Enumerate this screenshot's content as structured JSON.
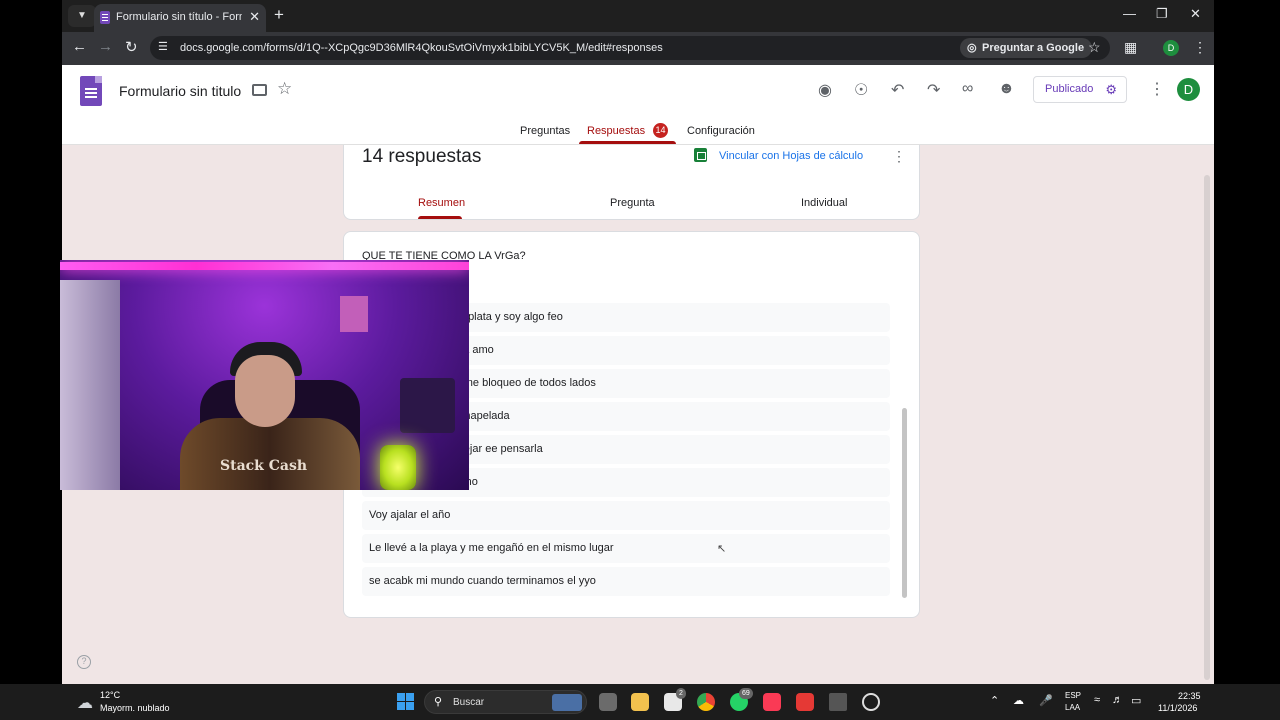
{
  "browser": {
    "tab_title": "Formulario sin título - Formular",
    "url": "docs.google.com/forms/d/1Q--XCpQgc9D36MlR4QkouSvtOiVmyxk1bibLYCV5K_M/edit#responses",
    "ask_google_label": "Preguntar a Google",
    "profile_initial": "D"
  },
  "form": {
    "title": "Formulario sin titulo",
    "publish_label": "Publicado",
    "avatar_initial": "D",
    "tabs": [
      {
        "label": "Preguntas"
      },
      {
        "label": "Respuestas"
      },
      {
        "label": "Configuración"
      }
    ],
    "responses_badge": "14"
  },
  "summary": {
    "count_text": "14 respuestas",
    "link_sheets_label": "Vincular con Hojas de cálculo",
    "subtabs": [
      {
        "label": "Resumen"
      },
      {
        "label": "Pregunta"
      },
      {
        "label": "Individual"
      }
    ]
  },
  "question": {
    "title": "QUE TE TIENE COMO LA VrGa?",
    "answers": [
      "er novia si no tengo plata y soy algo feo",
      "e alejamiento y yo la amo",
      "le que la amo si ya me bloqueo de todos lados",
      "er para hablarle a unapelada",
      "extraño no puedo dejar ee pensarla",
      "para coger y yo leamo",
      "Voy ajalar el año",
      "Le llevé a la playa y me engañó en el mismo lugar",
      "se acabk mi mundo cuando terminamos el yyo"
    ]
  },
  "webcam": {
    "jacket_text": "Stack Cash"
  },
  "taskbar": {
    "weather_temp": "12°C",
    "weather_desc": "Mayorm. nublado",
    "search_label": "Buscar",
    "badge_1": "2",
    "badge_2": "69",
    "lang_1": "ESP",
    "lang_2": "LAA",
    "time": "22:35",
    "date": "11/1/2026"
  },
  "colors": {
    "accent_red": "#a50e0e",
    "forms_purple": "#7248b9",
    "page_background": "#f0e5e5"
  }
}
